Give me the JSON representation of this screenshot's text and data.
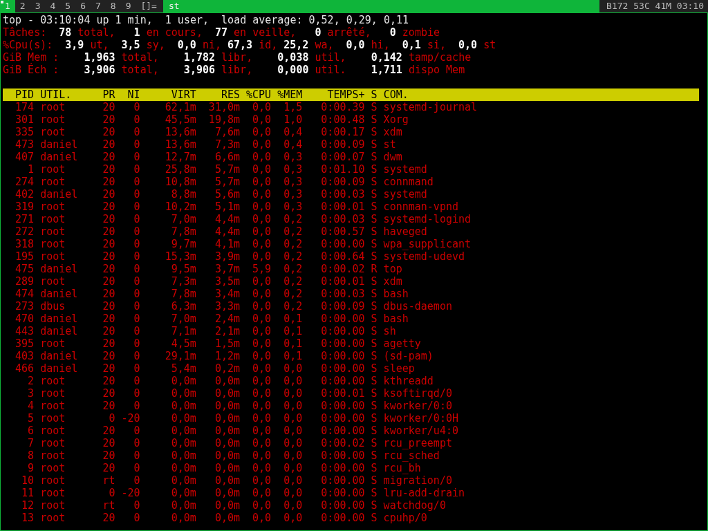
{
  "bar": {
    "tags": [
      {
        "label": "1",
        "selected": true,
        "occupied": true
      },
      {
        "label": "2",
        "selected": false,
        "occupied": false
      },
      {
        "label": "3",
        "selected": false,
        "occupied": false
      },
      {
        "label": "4",
        "selected": false,
        "occupied": false
      },
      {
        "label": "5",
        "selected": false,
        "occupied": false
      },
      {
        "label": "6",
        "selected": false,
        "occupied": false
      },
      {
        "label": "7",
        "selected": false,
        "occupied": false
      },
      {
        "label": "8",
        "selected": false,
        "occupied": false
      },
      {
        "label": "9",
        "selected": false,
        "occupied": false
      }
    ],
    "layout": "[]=",
    "window_title": "st",
    "status": "B172 53C 41M 03:10"
  },
  "summary": [
    {
      "kind": "uptime",
      "text": "top - 03:10:04 up 1 min,  1 user,  load average: 0,52, 0,29, 0,11"
    },
    {
      "kind": "tasks",
      "segments": [
        {
          "kind": "label",
          "text": "Tâches:"
        },
        {
          "kind": "value",
          "text": "78"
        },
        {
          "kind": "label",
          "text": "total,"
        },
        {
          "kind": "value",
          "text": "1"
        },
        {
          "kind": "label",
          "text": "en cours,"
        },
        {
          "kind": "value",
          "text": "77"
        },
        {
          "kind": "label",
          "text": "en veille,"
        },
        {
          "kind": "value",
          "text": "0"
        },
        {
          "kind": "label",
          "text": "arrêté,"
        },
        {
          "kind": "value",
          "text": "0"
        },
        {
          "kind": "label",
          "text": "zombie"
        }
      ]
    },
    {
      "kind": "cpu",
      "segments": [
        {
          "kind": "label",
          "text": "%Cpu(s):"
        },
        {
          "kind": "value",
          "text": "3,9"
        },
        {
          "kind": "label",
          "text": "ut,"
        },
        {
          "kind": "value",
          "text": "3,5"
        },
        {
          "kind": "label",
          "text": "sy,"
        },
        {
          "kind": "value",
          "text": "0,0"
        },
        {
          "kind": "label",
          "text": "ni,"
        },
        {
          "kind": "value",
          "text": "67,3"
        },
        {
          "kind": "label",
          "text": "id,"
        },
        {
          "kind": "value",
          "text": "25,2"
        },
        {
          "kind": "label",
          "text": "wa,"
        },
        {
          "kind": "value",
          "text": "0,0"
        },
        {
          "kind": "label",
          "text": "hi,"
        },
        {
          "kind": "value",
          "text": "0,1"
        },
        {
          "kind": "label",
          "text": "si,"
        },
        {
          "kind": "value",
          "text": "0,0"
        },
        {
          "kind": "label",
          "text": "st"
        }
      ]
    },
    {
      "kind": "memory",
      "segments": [
        {
          "kind": "label",
          "text": "GiB Mem :"
        },
        {
          "kind": "value",
          "text": "1,963"
        },
        {
          "kind": "label",
          "text": "total,"
        },
        {
          "kind": "value",
          "text": "1,782"
        },
        {
          "kind": "label",
          "text": "libr,"
        },
        {
          "kind": "value",
          "text": "0,038"
        },
        {
          "kind": "label",
          "text": "util,"
        },
        {
          "kind": "value",
          "text": "0,142"
        },
        {
          "kind": "label",
          "text": "tamp/cache"
        }
      ]
    },
    {
      "kind": "memory",
      "segments": [
        {
          "kind": "label",
          "text": "GiB Éch :"
        },
        {
          "kind": "value",
          "text": "3,906"
        },
        {
          "kind": "label",
          "text": "total,"
        },
        {
          "kind": "value",
          "text": "3,906"
        },
        {
          "kind": "label",
          "text": "libr,"
        },
        {
          "kind": "value",
          "text": "0,000"
        },
        {
          "kind": "label",
          "text": "util."
        },
        {
          "kind": "value",
          "text": "1,711"
        },
        {
          "kind": "label",
          "text": "dispo Mem"
        }
      ]
    }
  ],
  "table": {
    "columns": [
      "PID",
      "UTIL.",
      "PR",
      "NI",
      "VIRT",
      "RES",
      "%CPU",
      "%MEM",
      "TEMPS+",
      "S",
      "COM."
    ],
    "rows": [
      [
        "174",
        "root",
        "20",
        "0",
        "62,1m",
        "31,0m",
        "0,0",
        "1,5",
        "0:00.39",
        "S",
        "systemd-journal"
      ],
      [
        "301",
        "root",
        "20",
        "0",
        "45,5m",
        "19,8m",
        "0,0",
        "1,0",
        "0:00.48",
        "S",
        "Xorg"
      ],
      [
        "335",
        "root",
        "20",
        "0",
        "13,6m",
        "7,6m",
        "0,0",
        "0,4",
        "0:00.17",
        "S",
        "xdm"
      ],
      [
        "473",
        "daniel",
        "20",
        "0",
        "13,6m",
        "7,3m",
        "0,0",
        "0,4",
        "0:00.09",
        "S",
        "st"
      ],
      [
        "407",
        "daniel",
        "20",
        "0",
        "12,7m",
        "6,6m",
        "0,0",
        "0,3",
        "0:00.07",
        "S",
        "dwm"
      ],
      [
        "1",
        "root",
        "20",
        "0",
        "25,8m",
        "5,7m",
        "0,0",
        "0,3",
        "0:01.10",
        "S",
        "systemd"
      ],
      [
        "274",
        "root",
        "20",
        "0",
        "10,8m",
        "5,7m",
        "0,0",
        "0,3",
        "0:00.09",
        "S",
        "connmand"
      ],
      [
        "402",
        "daniel",
        "20",
        "0",
        "8,8m",
        "5,6m",
        "0,0",
        "0,3",
        "0:00.03",
        "S",
        "systemd"
      ],
      [
        "319",
        "root",
        "20",
        "0",
        "10,2m",
        "5,1m",
        "0,0",
        "0,3",
        "0:00.01",
        "S",
        "connman-vpnd"
      ],
      [
        "271",
        "root",
        "20",
        "0",
        "7,0m",
        "4,4m",
        "0,0",
        "0,2",
        "0:00.03",
        "S",
        "systemd-logind"
      ],
      [
        "272",
        "root",
        "20",
        "0",
        "7,8m",
        "4,4m",
        "0,0",
        "0,2",
        "0:00.57",
        "S",
        "haveged"
      ],
      [
        "318",
        "root",
        "20",
        "0",
        "9,7m",
        "4,1m",
        "0,0",
        "0,2",
        "0:00.00",
        "S",
        "wpa_supplicant"
      ],
      [
        "195",
        "root",
        "20",
        "0",
        "15,3m",
        "3,9m",
        "0,0",
        "0,2",
        "0:00.64",
        "S",
        "systemd-udevd"
      ],
      [
        "475",
        "daniel",
        "20",
        "0",
        "9,5m",
        "3,7m",
        "5,9",
        "0,2",
        "0:00.02",
        "R",
        "top"
      ],
      [
        "289",
        "root",
        "20",
        "0",
        "7,3m",
        "3,5m",
        "0,0",
        "0,2",
        "0:00.01",
        "S",
        "xdm"
      ],
      [
        "474",
        "daniel",
        "20",
        "0",
        "7,8m",
        "3,4m",
        "0,0",
        "0,2",
        "0:00.03",
        "S",
        "bash"
      ],
      [
        "273",
        "dbus",
        "20",
        "0",
        "6,3m",
        "3,3m",
        "0,0",
        "0,2",
        "0:00.09",
        "S",
        "dbus-daemon"
      ],
      [
        "470",
        "daniel",
        "20",
        "0",
        "7,0m",
        "2,4m",
        "0,0",
        "0,1",
        "0:00.00",
        "S",
        "bash"
      ],
      [
        "443",
        "daniel",
        "20",
        "0",
        "7,1m",
        "2,1m",
        "0,0",
        "0,1",
        "0:00.00",
        "S",
        "sh"
      ],
      [
        "395",
        "root",
        "20",
        "0",
        "4,5m",
        "1,5m",
        "0,0",
        "0,1",
        "0:00.00",
        "S",
        "agetty"
      ],
      [
        "403",
        "daniel",
        "20",
        "0",
        "29,1m",
        "1,2m",
        "0,0",
        "0,1",
        "0:00.00",
        "S",
        "(sd-pam)"
      ],
      [
        "466",
        "daniel",
        "20",
        "0",
        "5,4m",
        "0,2m",
        "0,0",
        "0,0",
        "0:00.00",
        "S",
        "sleep"
      ],
      [
        "2",
        "root",
        "20",
        "0",
        "0,0m",
        "0,0m",
        "0,0",
        "0,0",
        "0:00.00",
        "S",
        "kthreadd"
      ],
      [
        "3",
        "root",
        "20",
        "0",
        "0,0m",
        "0,0m",
        "0,0",
        "0,0",
        "0:00.01",
        "S",
        "ksoftirqd/0"
      ],
      [
        "4",
        "root",
        "20",
        "0",
        "0,0m",
        "0,0m",
        "0,0",
        "0,0",
        "0:00.00",
        "S",
        "kworker/0:0"
      ],
      [
        "5",
        "root",
        "0",
        "-20",
        "0,0m",
        "0,0m",
        "0,0",
        "0,0",
        "0:00.00",
        "S",
        "kworker/0:0H"
      ],
      [
        "6",
        "root",
        "20",
        "0",
        "0,0m",
        "0,0m",
        "0,0",
        "0,0",
        "0:00.00",
        "S",
        "kworker/u4:0"
      ],
      [
        "7",
        "root",
        "20",
        "0",
        "0,0m",
        "0,0m",
        "0,0",
        "0,0",
        "0:00.02",
        "S",
        "rcu_preempt"
      ],
      [
        "8",
        "root",
        "20",
        "0",
        "0,0m",
        "0,0m",
        "0,0",
        "0,0",
        "0:00.00",
        "S",
        "rcu_sched"
      ],
      [
        "9",
        "root",
        "20",
        "0",
        "0,0m",
        "0,0m",
        "0,0",
        "0,0",
        "0:00.00",
        "S",
        "rcu_bh"
      ],
      [
        "10",
        "root",
        "rt",
        "0",
        "0,0m",
        "0,0m",
        "0,0",
        "0,0",
        "0:00.00",
        "S",
        "migration/0"
      ],
      [
        "11",
        "root",
        "0",
        "-20",
        "0,0m",
        "0,0m",
        "0,0",
        "0,0",
        "0:00.00",
        "S",
        "lru-add-drain"
      ],
      [
        "12",
        "root",
        "rt",
        "0",
        "0,0m",
        "0,0m",
        "0,0",
        "0,0",
        "0:00.00",
        "S",
        "watchdog/0"
      ],
      [
        "13",
        "root",
        "20",
        "0",
        "0,0m",
        "0,0m",
        "0,0",
        "0,0",
        "0:00.00",
        "S",
        "cpuhp/0"
      ]
    ]
  }
}
